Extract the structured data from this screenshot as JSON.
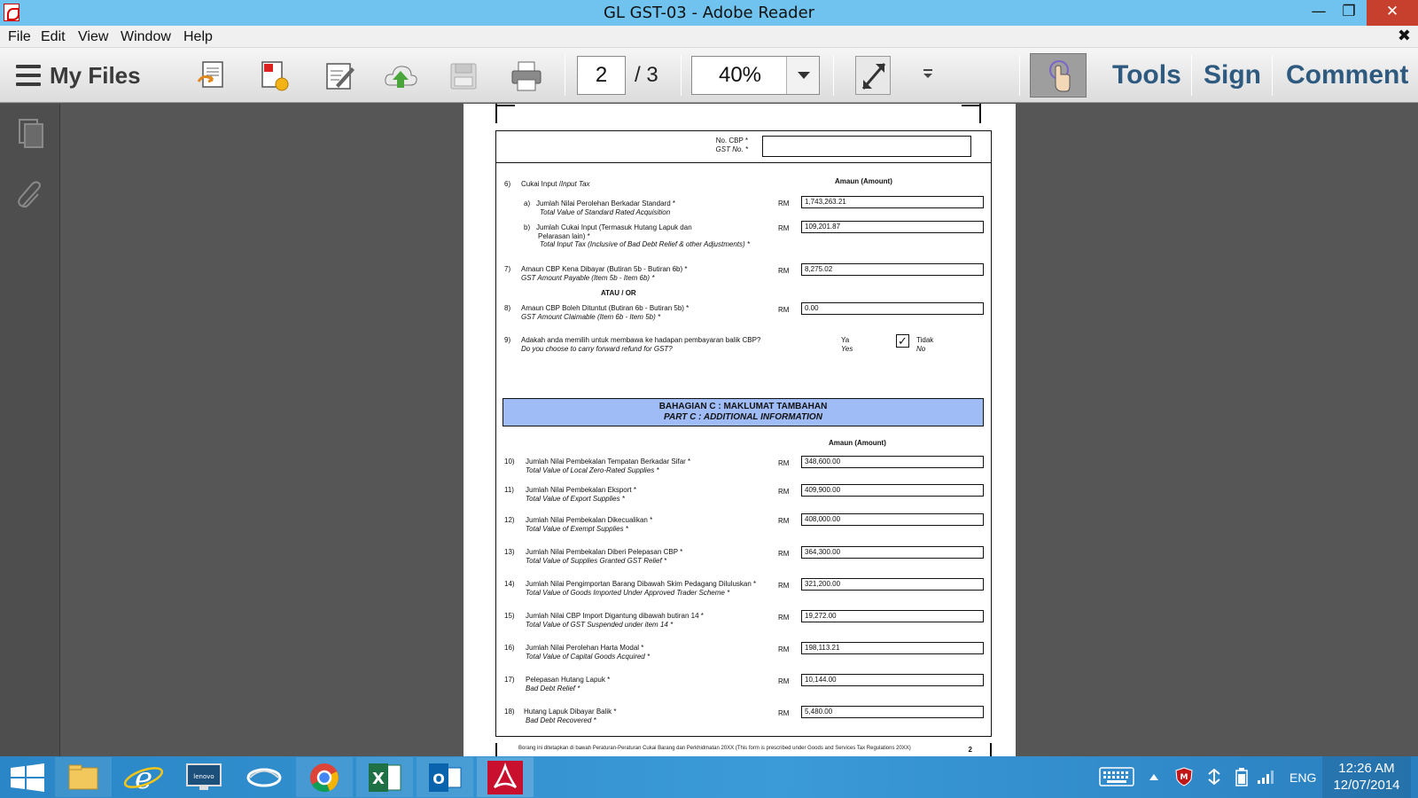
{
  "window": {
    "title": "GL GST-03 - Adobe Reader",
    "minimize": "—",
    "restore": "❐",
    "close": "✕"
  },
  "menu": {
    "items": [
      "File",
      "Edit",
      "View",
      "Window",
      "Help"
    ],
    "close": "✖"
  },
  "toolbar": {
    "my_files": "My Files",
    "page_current": "2",
    "page_total": "/ 3",
    "zoom": "40%",
    "tools": "Tools",
    "sign": "Sign",
    "comment": "Comment"
  },
  "document": {
    "gst_no_label_ms": "No. CBP *",
    "gst_no_label_en": "GST No. *",
    "amount_header": "Amaun (Amount)",
    "item6": {
      "num": "6)",
      "ms": "Cukai Input /",
      "en": "Input Tax"
    },
    "item6a": {
      "num": "a)",
      "ms": "Jumlah Nilai Perolehan Berkadar Standard *",
      "en": "Total Value of Standard Rated Acquisition",
      "value": "1,743,263.21"
    },
    "item6b": {
      "num": "b)",
      "ms1": "Jumlah Cukai Input (Termasuk Hutang Lapuk dan",
      "ms2": "Pelarasan lain) *",
      "en": "Total Input Tax (Inclusive of Bad Debt Relief & other Adjustments) *",
      "value": "109,201.87"
    },
    "item7": {
      "num": "7)",
      "ms": "Amaun CBP Kena Dibayar (Butiran 5b - Butiran 6b) *",
      "en": "GST Amount Payable (Item 5b - Item 6b) *",
      "value": "8,275.02"
    },
    "atau": "ATAU / OR",
    "item8": {
      "num": "8)",
      "ms": "Amaun CBP Boleh Dituntut (Butiran 6b - Butiran 5b) *",
      "en": "GST Amount Claimable (Item 6b - Item 5b) *",
      "value": "0.00"
    },
    "item9": {
      "num": "9)",
      "ms": "Adakah anda memilih untuk membawa ke hadapan pembayaran balik CBP?",
      "en": "Do you choose to carry forward refund for GST?",
      "yes_ms": "Ya",
      "yes_en": "Yes",
      "no_ms": "Tidak",
      "no_en": "No",
      "checked": "✓"
    },
    "part_c_ms": "BAHAGIAN C : MAKLUMAT TAMBAHAN",
    "part_c_en": "PART C : ADDITIONAL INFORMATION",
    "amount_header_c": "Amaun (Amount)",
    "rm": "RM",
    "items_c": [
      {
        "num": "10)",
        "ms": "Jumlah Nilai Pembekalan Tempatan Berkadar Sifar *",
        "en": "Total Value of Local Zero-Rated Supplies *",
        "value": "348,600.00"
      },
      {
        "num": "11)",
        "ms": "Jumlah Nilai Pembekalan Eksport *",
        "en": "Total Value of Export Supplies  *",
        "value": "409,900.00"
      },
      {
        "num": "12)",
        "ms": "Jumlah Nilai Pembekalan Dikecualikan *",
        "en": "Total Value of Exempt Supplies  *",
        "value": "408,000.00"
      },
      {
        "num": "13)",
        "ms": "Jumlah Nilai Pembekalan Diberi Pelepasan CBP *",
        "en": "Total Value of Supplies Granted GST Relief *",
        "value": "364,300.00"
      },
      {
        "num": "14)",
        "ms": "Jumlah Nilai Pengimportan Barang Dibawah Skim Pedagang Diluluskan *",
        "en": "Total Value of Goods Imported Under Approved Trader Scheme *",
        "value": "321,200.00"
      },
      {
        "num": "15)",
        "ms": "Jumlah Nilai CBP Import Digantung dibawah butiran 14 *",
        "en": "Total Value of GST Suspended under item 14 *",
        "value": "19,272.00"
      },
      {
        "num": "16)",
        "ms": "Jumlah Nilai Perolehan Harta Modal  *",
        "en": "Total Value of Capital Goods Acquired  *",
        "value": "198,113.21"
      },
      {
        "num": "17)",
        "ms": "Pelepasan Hutang Lapuk *",
        "en": "Bad Debt Relief *",
        "value": "10,144.00"
      },
      {
        "num": "18)",
        "ms": "Hutang Lapuk Dibayar Balik *",
        "en": "Bad Debt Recovered *",
        "value": "5,480.00"
      }
    ],
    "footer_text": "Borang ini ditetapkan di bawah Peraturan-Peraturan Cukai Barang dan Perkhidmatan 20XX (This form is prescribed under Goods and Services Tax Regulations 20XX)",
    "page_number": "2"
  },
  "taskbar": {
    "language": "ENG",
    "time": "12:26 AM",
    "date": "12/07/2014"
  },
  "colors": {
    "titlebar": "#6fc3ee",
    "part_c_header": "#9fbcf7",
    "tab_text": "#2e5a7f",
    "taskbar": "#2a86c6"
  }
}
